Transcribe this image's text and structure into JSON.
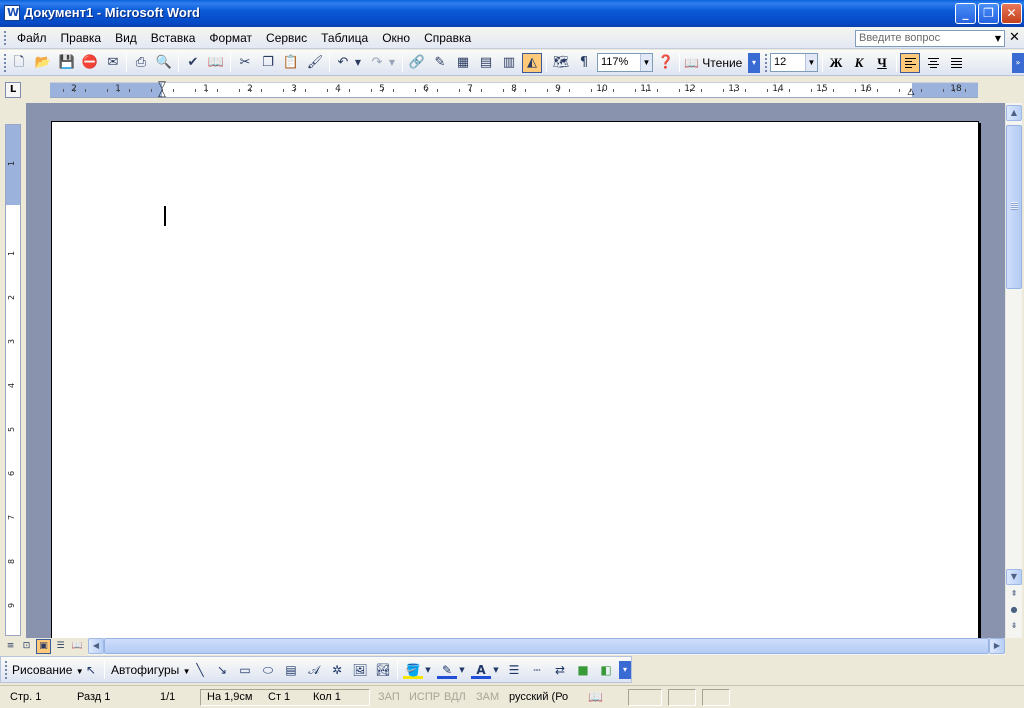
{
  "window": {
    "title": "Документ1 - Microsoft Word",
    "minimize": "_",
    "restore": "❐",
    "close": "✕"
  },
  "menu": {
    "items": [
      "Файл",
      "Правка",
      "Вид",
      "Вставка",
      "Формат",
      "Сервис",
      "Таблица",
      "Окно",
      "Справка"
    ],
    "ask_placeholder": "Введите вопрос"
  },
  "toolbar": {
    "zoom": "117%",
    "read_label": "Чтение",
    "font_size": "12",
    "bold": "Ж",
    "italic": "К",
    "underline": "Ч",
    "icons": [
      "new-icon",
      "open-icon",
      "save-icon",
      "permission-icon",
      "email-icon",
      "print-icon",
      "print-preview-icon",
      "spelling-icon",
      "research-icon",
      "cut-icon",
      "copy-icon",
      "paste-icon",
      "format-painter-icon",
      "undo-icon",
      "redo-icon",
      "hyperlink-icon",
      "tables-borders-icon",
      "insert-table-icon",
      "insert-excel-icon",
      "columns-icon",
      "drawing-icon",
      "document-map-icon",
      "show-formatting-icon",
      "help-icon"
    ]
  },
  "ruler": {
    "h_labels": [
      "2",
      "1",
      "1",
      "2",
      "3",
      "4",
      "5",
      "6",
      "7",
      "8",
      "9",
      "10",
      "11",
      "12",
      "13",
      "14",
      "15",
      "16",
      "18"
    ],
    "v_labels": [
      "1",
      "1",
      "2",
      "3",
      "4",
      "5",
      "6",
      "7",
      "8",
      "9"
    ],
    "corner": "L"
  },
  "drawing": {
    "draw_label": "Рисование",
    "autoshapes_label": "Автофигуры"
  },
  "status": {
    "page": "Стр. 1",
    "section": "Разд 1",
    "pages": "1/1",
    "at": "На 1,9см",
    "line": "Ст 1",
    "col": "Кол 1",
    "rec": "ЗАП",
    "trk": "ИСПР",
    "ext": "ВДЛ",
    "ovr": "ЗАМ",
    "language": "русский (Ро"
  }
}
